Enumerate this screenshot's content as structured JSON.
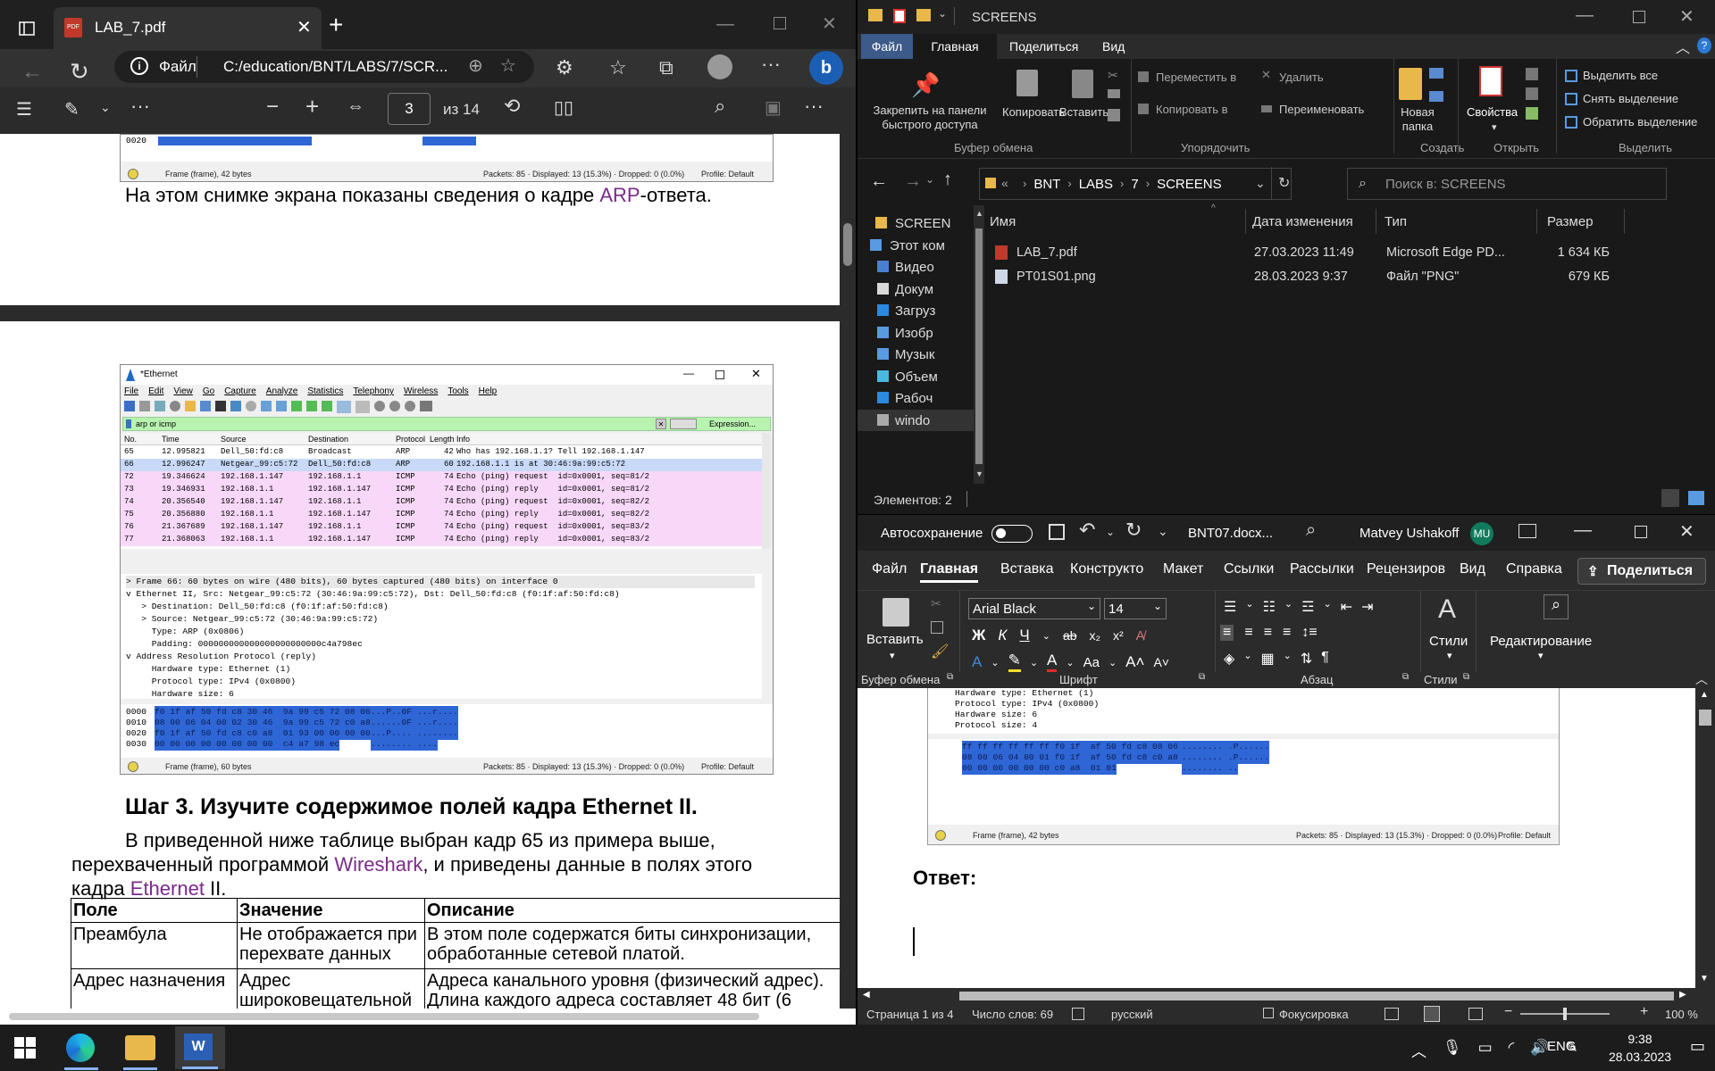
{
  "edge": {
    "tab_title": "LAB_7.pdf",
    "file_label": "Файл",
    "url": "C:/education/BNT/LABS/7/SCR...",
    "page_current": "3",
    "page_total": "из 14"
  },
  "pdf": {
    "top_caption_prefix": "На этом снимке экрана показаны сведения о кадре ",
    "top_caption_link": "ARP",
    "top_caption_suffix": "-ответа.",
    "ws_top_status": {
      "frame": "Frame (frame), 42 bytes",
      "packets": "Packets: 85 · Displayed: 13 (15.3%) · Dropped: 0 (0.0%)",
      "profile": "Profile: Default",
      "hex_row": "0020"
    },
    "ws": {
      "title": "*Ethernet",
      "menu": [
        "File",
        "Edit",
        "View",
        "Go",
        "Capture",
        "Analyze",
        "Statistics",
        "Telephony",
        "Wireless",
        "Tools",
        "Help"
      ],
      "filter": "arp or icmp",
      "expression": "Expression...",
      "columns": [
        "No.",
        "Time",
        "Source",
        "Destination",
        "Protocol",
        "Length",
        "Info"
      ],
      "rows": [
        [
          "65",
          "12.995821",
          "Dell_50:fd:c8",
          "Broadcast",
          "ARP",
          "42",
          "Who has 192.168.1.1? Tell 192.168.1.147"
        ],
        [
          "66",
          "12.996247",
          "Netgear_99:c5:72",
          "Dell_50:fd:c8",
          "ARP",
          "60",
          "192.168.1.1 is at 30:46:9a:99:c5:72"
        ],
        [
          "72",
          "19.346624",
          "192.168.1.147",
          "192.168.1.1",
          "ICMP",
          "74",
          "Echo (ping) request  id=0x0001, seq=81/2"
        ],
        [
          "73",
          "19.346931",
          "192.168.1.1",
          "192.168.1.147",
          "ICMP",
          "74",
          "Echo (ping) reply    id=0x0001, seq=81/2"
        ],
        [
          "74",
          "20.356540",
          "192.168.1.147",
          "192.168.1.1",
          "ICMP",
          "74",
          "Echo (ping) request  id=0x0001, seq=82/2"
        ],
        [
          "75",
          "20.356880",
          "192.168.1.1",
          "192.168.1.147",
          "ICMP",
          "74",
          "Echo (ping) reply    id=0x0001, seq=82/2"
        ],
        [
          "76",
          "21.367689",
          "192.168.1.147",
          "192.168.1.1",
          "ICMP",
          "74",
          "Echo (ping) request  id=0x0001, seq=83/2"
        ],
        [
          "77",
          "21.368063",
          "192.168.1.1",
          "192.168.1.147",
          "ICMP",
          "74",
          "Echo (ping) reply    id=0x0001, seq=83/2"
        ]
      ],
      "details": [
        "> Frame 66: 60 bytes on wire (480 bits), 60 bytes captured (480 bits) on interface 0",
        "v Ethernet II, Src: Netgear_99:c5:72 (30:46:9a:99:c5:72), Dst: Dell_50:fd:c8 (f0:1f:af:50:fd:c8)",
        "   > Destination: Dell_50:fd:c8 (f0:1f:af:50:fd:c8)",
        "   > Source: Netgear_99:c5:72 (30:46:9a:99:c5:72)",
        "     Type: ARP (0x0806)",
        "     Padding: 000000000000000000000000c4a798ec",
        "v Address Resolution Protocol (reply)",
        "     Hardware type: Ethernet (1)",
        "     Protocol type: IPv4 (0x0800)",
        "     Hardware size: 6"
      ],
      "hex": [
        [
          "0000",
          "f0 1f af 50 fd c8 30 46  9a 99 c5 72 08 06 00 01",
          "...P..0F ...r...."
        ],
        [
          "0010",
          "08 00 06 04 00 02 30 46  9a 99 c5 72 c0 a8 01 01",
          "......0F ...r...."
        ],
        [
          "0020",
          "f0 1f af 50 fd c8 c0 a8  01 93 00 00 00 00 00 00",
          "...P.... ........"
        ],
        [
          "0030",
          "00 00 00 00 00 00 00 00  c4 a7 98 ec",
          "........ ...."
        ]
      ],
      "status_frame": "Frame (frame), 60 bytes",
      "status_packets": "Packets: 85 · Displayed: 13 (15.3%) · Dropped: 0 (0.0%)",
      "status_profile": "Profile: Default"
    },
    "step_heading": "Шаг 3. Изучите содержимое полей кадра Ethernet II.",
    "para_1": "В приведенной ниже таблице выбран кадр 65 из примера выше,",
    "para_2a": "перехваченный программой ",
    "para_2link": "Wireshark",
    "para_2b": ", и приведены данные в полях этого",
    "para_3a": "кадра ",
    "para_3link": "Ethernet",
    "para_3b": " II.",
    "table": {
      "headers": [
        "Поле",
        "Значение",
        "Описание"
      ],
      "rows": [
        [
          "Преамбула",
          "Не отображается при перехвате данных",
          "В этом поле содержатся биты синхронизации, обработанные сетевой платой."
        ],
        [
          "Адрес назначения",
          "Адрес широковещательной",
          "Адреса канального уровня (физический адрес). Длина каждого адреса составляет 48 бит (6"
        ]
      ]
    }
  },
  "explorer": {
    "title": "SCREENS",
    "ribbon_tabs": [
      "Файл",
      "Главная",
      "Поделиться",
      "Вид"
    ],
    "active_tab": "Главная",
    "clipboard": {
      "pin": "Закрепить на панели быстрого доступа",
      "copy": "Копировать",
      "paste": "Вставить",
      "group": "Буфер обмена"
    },
    "organize": {
      "move": "Переместить в",
      "copy_to": "Копировать в",
      "delete": "Удалить",
      "rename": "Переименовать",
      "group": "Упорядочить"
    },
    "create": {
      "new_folder": "Новая папка",
      "group": "Создать"
    },
    "open": {
      "properties": "Свойства",
      "group": "Открыть"
    },
    "select": {
      "all": "Выделить все",
      "none": "Снять выделение",
      "invert": "Обратить выделение",
      "group": "Выделить"
    },
    "breadcrumb": [
      "BNT",
      "LABS",
      "7",
      "SCREENS"
    ],
    "search_placeholder": "Поиск в: SCREENS",
    "columns": [
      "Имя",
      "Дата изменения",
      "Тип",
      "Размер"
    ],
    "files": [
      {
        "name": "LAB_7.pdf",
        "date": "27.03.2023 11:49",
        "type": "Microsoft Edge PD...",
        "size": "1 634 КБ"
      },
      {
        "name": "PT01S01.png",
        "date": "28.03.2023 9:37",
        "type": "Файл \"PNG\"",
        "size": "679 КБ"
      }
    ],
    "nav": [
      "SCREEN",
      "Этот ком",
      "Видео",
      "Докум",
      "Загруз",
      "Изобр",
      "Музык",
      "Объем",
      "Рабоч",
      "windo"
    ],
    "status": "Элементов: 2"
  },
  "word": {
    "autosave": "Автосохранение",
    "doc_name": "BNT07.docx...",
    "user": "Matvey Ushakoff",
    "initials": "MU",
    "tabs": [
      "Файл",
      "Главная",
      "Вставка",
      "Конструкто",
      "Макет",
      "Ссылки",
      "Рассылки",
      "Рецензиров",
      "Вид",
      "Справка"
    ],
    "active_tab": "Главная",
    "share": "Поделиться",
    "paste": "Вставить",
    "font_name": "Arial Black",
    "font_size": "14",
    "styles": "Стили",
    "editing": "Редактирование",
    "groups": [
      "Буфер обмена",
      "Шрифт",
      "Абзац",
      "Стили"
    ],
    "doc_ws_details": [
      "Hardware type: Ethernet (1)",
      "Protocol type: IPv4 (0x0800)",
      "Hardware size: 6",
      "Protocol size: 4"
    ],
    "doc_ws_hex": [
      [
        "0000",
        "ff ff ff ff ff ff f0 1f  af 50 fd c8 08 06 00 01",
        "........ .P......"
      ],
      [
        "0010",
        "08 00 06 04 00 01 f0 1f  af 50 fd c8 c0 a8 01 93",
        "........ .P......"
      ],
      [
        "0020",
        "00 00 00 00 00 00 c0 a8  01 01",
        "........ .."
      ]
    ],
    "doc_ws_status": {
      "frame": "Frame (frame), 42 bytes",
      "packets": "Packets: 85 · Displayed: 13 (15.3%) · Dropped: 0 (0.0%)",
      "profile": "Profile: Default"
    },
    "answer": "Ответ:",
    "status": {
      "page": "Страница 1 из 4",
      "words": "Число слов: 69",
      "lang": "русский",
      "focus": "Фокусировка",
      "zoom": "100 %"
    }
  },
  "taskbar": {
    "lang": "ENG",
    "time": "9:38",
    "date": "28.03.2023"
  }
}
